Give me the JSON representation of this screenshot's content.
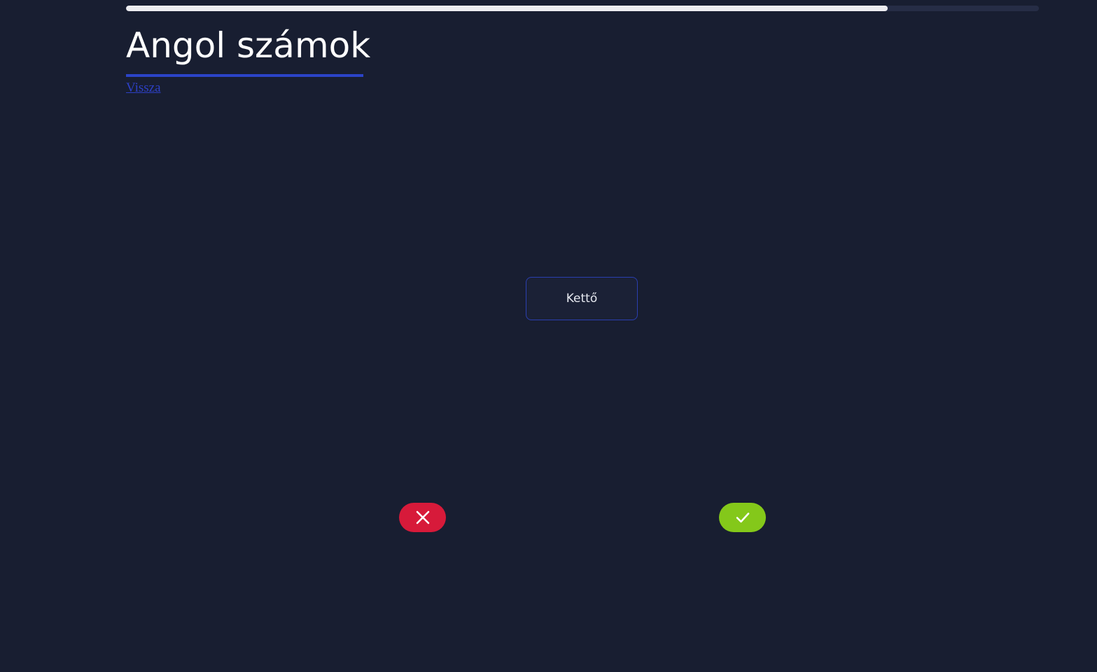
{
  "progress": {
    "value": 0.834,
    "fill_color": "#ececf0",
    "track_color": "#262d46"
  },
  "header": {
    "title": "Angol számok",
    "back_link": "Vissza",
    "underline_color": "#2b44c8"
  },
  "card": {
    "text": "Kettő"
  },
  "actions": {
    "wrong": {
      "icon": "close-icon",
      "color": "#d71a3a"
    },
    "right": {
      "icon": "check-icon",
      "color": "#84c81a"
    }
  }
}
